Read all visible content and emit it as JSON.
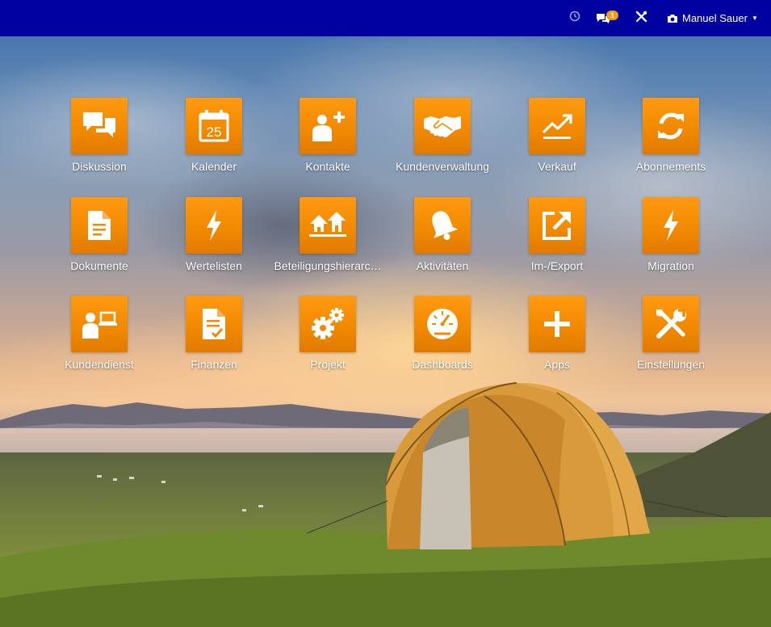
{
  "topbar": {
    "history_icon": "clock-icon",
    "chat_icon": "comments-icon",
    "chat_badge": "1",
    "tools_icon": "tools-icon",
    "user_icon": "camera-icon",
    "user_name": "Manuel Sauer",
    "caret_icon": "caret-down-icon"
  },
  "colors": {
    "topbar": "#0000a0",
    "tile": "#f28a00",
    "badge": "#f39c12"
  },
  "apps": [
    {
      "label": "Diskussion",
      "icon": "chat-bubbles-icon"
    },
    {
      "label": "Kalender",
      "icon": "calendar-icon"
    },
    {
      "label": "Kontakte",
      "icon": "add-user-icon"
    },
    {
      "label": "Kundenverwaltung",
      "icon": "handshake-icon"
    },
    {
      "label": "Verkauf",
      "icon": "trend-up-icon"
    },
    {
      "label": "Abonnements",
      "icon": "refresh-icon"
    },
    {
      "label": "Dokumente",
      "icon": "document-icon"
    },
    {
      "label": "Wertelisten",
      "icon": "lightning-icon"
    },
    {
      "label": "Beteiligungshierarc…",
      "icon": "houses-icon"
    },
    {
      "label": "Aktivitäten",
      "icon": "bell-icon"
    },
    {
      "label": "Im-/Export",
      "icon": "external-link-icon"
    },
    {
      "label": "Migration",
      "icon": "lightning-icon"
    },
    {
      "label": "Kundendienst",
      "icon": "support-laptop-icon"
    },
    {
      "label": "Finanzen",
      "icon": "invoice-check-icon"
    },
    {
      "label": "Projekt",
      "icon": "gears-icon"
    },
    {
      "label": "Dashboards",
      "icon": "gauge-icon"
    },
    {
      "label": "Apps",
      "icon": "plus-icon"
    },
    {
      "label": "Einstellungen",
      "icon": "wrench-screwdriver-icon"
    }
  ],
  "calendar_day": "25"
}
